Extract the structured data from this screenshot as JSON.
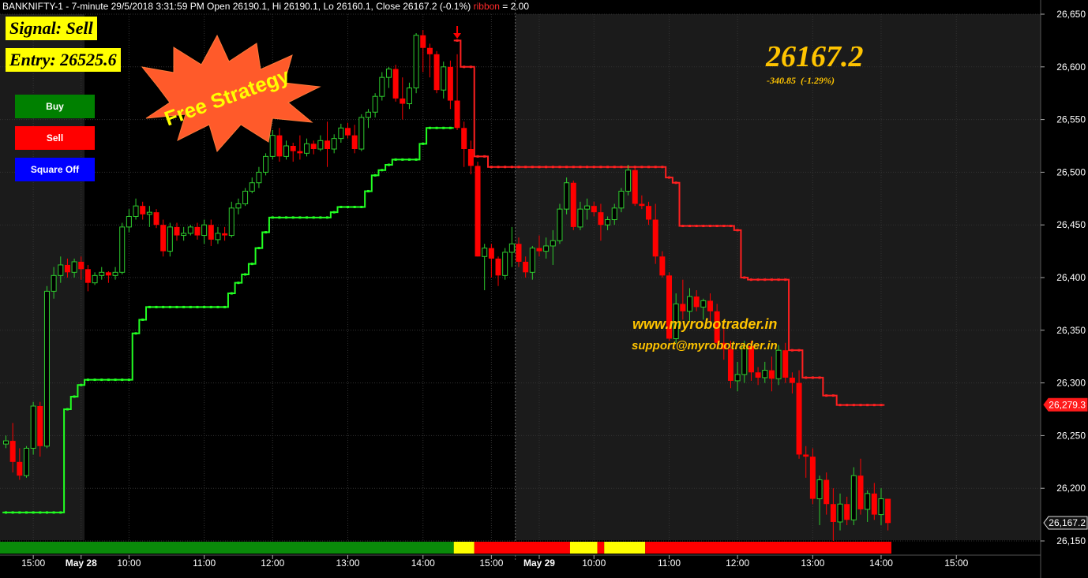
{
  "header": {
    "symbol": "BANKNIFTY-1",
    "info": " - 7-minute 29/5/2018 3:31:59 PM Open 26190.1, Hi 26190.1, Lo 26160.1, Close 26167.2 (-0.1%) ",
    "ribbon_label": "ribbon",
    "ribbon_value": " = 2.00"
  },
  "signal": {
    "label": "Signal: Sell",
    "entry": "Entry: 26525.6"
  },
  "buttons": {
    "buy": "Buy",
    "sell": "Sell",
    "square_off": "Square Off"
  },
  "badge": {
    "text": "Free Strategy"
  },
  "quote": {
    "price": "26167.2",
    "change": "-340.85  (-1.29%)"
  },
  "contact": {
    "website": "www.myrobotrader.in",
    "email": "support@myrobotrader.in"
  },
  "colors": {
    "up": "#2ecc2e",
    "down": "#ff0000",
    "support_line": "#22ff22",
    "resistance_line": "#ff2020",
    "ribbon_green": "#0a8a0a",
    "ribbon_yellow": "#ffff00",
    "ribbon_red": "#ff0000",
    "accent_text": "#ffc400",
    "buy_button": "#008000",
    "sell_button": "#ff0000",
    "square_off_button": "#0000ff"
  },
  "chart_data": {
    "type": "candlestick",
    "y_ticks": [
      26650,
      26600,
      26550,
      26500,
      26450,
      26400,
      26350,
      26300,
      26250,
      26200,
      26150
    ],
    "y_tick_labels": [
      "26,650",
      "26,600",
      "26,550",
      "26,500",
      "26,450",
      "26,400",
      "26,350",
      "26,300",
      "26,250",
      "26,200",
      "26,150"
    ],
    "ylim": [
      26125,
      26670
    ],
    "x_ticks": [
      {
        "bar": 4,
        "label": "15:00",
        "bold": false
      },
      {
        "bar": 11,
        "label": "May 28",
        "bold": true
      },
      {
        "bar": 18,
        "label": "10:00",
        "bold": false
      },
      {
        "bar": 29,
        "label": "11:00",
        "bold": false
      },
      {
        "bar": 39,
        "label": "12:00",
        "bold": false
      },
      {
        "bar": 50,
        "label": "13:00",
        "bold": false
      },
      {
        "bar": 61,
        "label": "14:00",
        "bold": false
      },
      {
        "bar": 71,
        "label": "15:00",
        "bold": false
      },
      {
        "bar": 78,
        "label": "May 29",
        "bold": true
      },
      {
        "bar": 86,
        "label": "10:00",
        "bold": false
      },
      {
        "bar": 97,
        "label": "11:00",
        "bold": false
      },
      {
        "bar": 107,
        "label": "12:00",
        "bold": false
      },
      {
        "bar": 118,
        "label": "13:00",
        "bold": false
      },
      {
        "bar": 128,
        "label": "14:00",
        "bold": false
      },
      {
        "bar": 139,
        "label": "15:00",
        "bold": false
      }
    ],
    "candles": [
      [
        26242,
        26250,
        26238,
        26245
      ],
      [
        26245,
        26262,
        26215,
        26225
      ],
      [
        26225,
        26238,
        26208,
        26212
      ],
      [
        26212,
        26240,
        26210,
        26238
      ],
      [
        26238,
        26282,
        26232,
        26278
      ],
      [
        26278,
        26282,
        26230,
        26240
      ],
      [
        26240,
        26392,
        26238,
        26387
      ],
      [
        26387,
        26410,
        26380,
        26402
      ],
      [
        26402,
        26420,
        26395,
        26412
      ],
      [
        26412,
        26418,
        26400,
        26405
      ],
      [
        26405,
        26418,
        26400,
        26415
      ],
      [
        26415,
        26420,
        26398,
        26408
      ],
      [
        26408,
        26412,
        26387,
        26395
      ],
      [
        26395,
        26405,
        26393,
        26402
      ],
      [
        26402,
        26410,
        26398,
        26405
      ],
      [
        26405,
        26406,
        26395,
        26402
      ],
      [
        26402,
        26410,
        26398,
        26405
      ],
      [
        26405,
        26452,
        26403,
        26448
      ],
      [
        26448,
        26465,
        26443,
        26458
      ],
      [
        26458,
        26475,
        26455,
        26468
      ],
      [
        26468,
        26472,
        26455,
        26460
      ],
      [
        26460,
        26468,
        26448,
        26462
      ],
      [
        26462,
        26465,
        26447,
        26450
      ],
      [
        26450,
        26455,
        26420,
        26425
      ],
      [
        26425,
        26452,
        26420,
        26448
      ],
      [
        26448,
        26452,
        26435,
        26440
      ],
      [
        26440,
        26448,
        26435,
        26442
      ],
      [
        26442,
        26450,
        26440,
        26448
      ],
      [
        26448,
        26452,
        26436,
        26440
      ],
      [
        26440,
        26455,
        26432,
        26450
      ],
      [
        26450,
        26455,
        26430,
        26436
      ],
      [
        26436,
        26448,
        26432,
        26442
      ],
      [
        26442,
        26448,
        26435,
        26440
      ],
      [
        26440,
        26472,
        26438,
        26466
      ],
      [
        26466,
        26475,
        26460,
        26470
      ],
      [
        26470,
        26485,
        26468,
        26482
      ],
      [
        26482,
        26495,
        26480,
        26490
      ],
      [
        26490,
        26505,
        26485,
        26500
      ],
      [
        26500,
        26518,
        26497,
        26515
      ],
      [
        26515,
        26540,
        26512,
        26535
      ],
      [
        26535,
        26542,
        26510,
        26515
      ],
      [
        26515,
        26530,
        26512,
        26525
      ],
      [
        26525,
        26528,
        26510,
        26520
      ],
      [
        26520,
        26535,
        26512,
        26518
      ],
      [
        26518,
        26532,
        26515,
        26527
      ],
      [
        26527,
        26530,
        26517,
        26522
      ],
      [
        26522,
        26535,
        26520,
        26530
      ],
      [
        26530,
        26548,
        26505,
        26522
      ],
      [
        26522,
        26536,
        26518,
        26532
      ],
      [
        26532,
        26546,
        26528,
        26542
      ],
      [
        26542,
        26547,
        26532,
        26535
      ],
      [
        26535,
        26545,
        26518,
        26522
      ],
      [
        26522,
        26555,
        26520,
        26552
      ],
      [
        26552,
        26560,
        26542,
        26557
      ],
      [
        26557,
        26575,
        26552,
        26572
      ],
      [
        26572,
        26595,
        26568,
        26590
      ],
      [
        26590,
        26600,
        26580,
        26598
      ],
      [
        26598,
        26602,
        26567,
        26570
      ],
      [
        26570,
        26590,
        26550,
        26565
      ],
      [
        26565,
        26585,
        26560,
        26580
      ],
      [
        26580,
        26632,
        26575,
        26630
      ],
      [
        26630,
        26635,
        26595,
        26618
      ],
      [
        26618,
        26622,
        26590,
        26612
      ],
      [
        26612,
        26615,
        26575,
        26578
      ],
      [
        26578,
        26605,
        26570,
        26600
      ],
      [
        26600,
        26606,
        26560,
        26568
      ],
      [
        26568,
        26612,
        26540,
        26542
      ],
      [
        26542,
        26548,
        26505,
        26522
      ],
      [
        26522,
        26530,
        26498,
        26506
      ],
      [
        26506,
        26510,
        26420,
        26420
      ],
      [
        26420,
        26432,
        26388,
        26428
      ],
      [
        26428,
        26432,
        26400,
        26418
      ],
      [
        26418,
        26420,
        26392,
        26402
      ],
      [
        26402,
        26428,
        26398,
        26424
      ],
      [
        26424,
        26448,
        26410,
        26432
      ],
      [
        26432,
        26438,
        26410,
        26415
      ],
      [
        26415,
        26420,
        26400,
        26405
      ],
      [
        26405,
        26430,
        26398,
        26428
      ],
      [
        26428,
        26440,
        26420,
        26425
      ],
      [
        26425,
        26438,
        26418,
        26430
      ],
      [
        26430,
        26445,
        26412,
        26435
      ],
      [
        26435,
        26470,
        26432,
        26465
      ],
      [
        26465,
        26495,
        26460,
        26490
      ],
      [
        26490,
        26492,
        26445,
        26448
      ],
      [
        26448,
        26472,
        26445,
        26465
      ],
      [
        26465,
        26475,
        26455,
        26468
      ],
      [
        26468,
        26472,
        26458,
        26462
      ],
      [
        26462,
        26470,
        26435,
        26450
      ],
      [
        26450,
        26458,
        26445,
        26455
      ],
      [
        26455,
        26470,
        26450,
        26466
      ],
      [
        26466,
        26485,
        26462,
        26482
      ],
      [
        26482,
        26507,
        26478,
        26502
      ],
      [
        26502,
        26504,
        26468,
        26470
      ],
      [
        26470,
        26478,
        26465,
        26468
      ],
      [
        26468,
        26472,
        26450,
        26455
      ],
      [
        26455,
        26470,
        26413,
        26420
      ],
      [
        26420,
        26425,
        26400,
        26402
      ],
      [
        26402,
        26405,
        26340,
        26342
      ],
      [
        26342,
        26385,
        26338,
        26375
      ],
      [
        26375,
        26398,
        26360,
        26368
      ],
      [
        26368,
        26390,
        26358,
        26382
      ],
      [
        26382,
        26388,
        26368,
        26372
      ],
      [
        26372,
        26380,
        26360,
        26378
      ],
      [
        26378,
        26385,
        26358,
        26368
      ],
      [
        26368,
        26375,
        26332,
        26338
      ],
      [
        26338,
        26355,
        26322,
        26332
      ],
      [
        26332,
        26340,
        26295,
        26302
      ],
      [
        26302,
        26320,
        26292,
        26308
      ],
      [
        26308,
        26340,
        26300,
        26335
      ],
      [
        26335,
        26340,
        26302,
        26310
      ],
      [
        26310,
        26315,
        26298,
        26305
      ],
      [
        26305,
        26320,
        26300,
        26312
      ],
      [
        26312,
        26325,
        26292,
        26304
      ],
      [
        26304,
        26336,
        26298,
        26331
      ],
      [
        26331,
        26338,
        26300,
        26305
      ],
      [
        26305,
        26310,
        26290,
        26300
      ],
      [
        26300,
        26312,
        26228,
        26232
      ],
      [
        26232,
        26240,
        26210,
        26230
      ],
      [
        26230,
        26238,
        26185,
        26190
      ],
      [
        26190,
        26212,
        26165,
        26208
      ],
      [
        26208,
        26215,
        26175,
        26185
      ],
      [
        26185,
        26200,
        26150,
        26168
      ],
      [
        26168,
        26195,
        26160,
        26185
      ],
      [
        26185,
        26192,
        26165,
        26170
      ],
      [
        26170,
        26220,
        26165,
        26212
      ],
      [
        26212,
        26228,
        26175,
        26180
      ],
      [
        26180,
        26198,
        26168,
        26195
      ],
      [
        26195,
        26205,
        26170,
        26175
      ],
      [
        26175,
        26200,
        26165,
        26190
      ],
      [
        26190,
        26190,
        26160,
        26167
      ]
    ],
    "support_line": [
      {
        "from": 0,
        "to": 8,
        "value": 26177
      },
      {
        "from": 9,
        "to": 9,
        "value": 26275
      },
      {
        "from": 10,
        "to": 10,
        "value": 26287
      },
      {
        "from": 11,
        "to": 11,
        "value": 26298
      },
      {
        "from": 12,
        "to": 18,
        "value": 26303
      },
      {
        "from": 19,
        "to": 19,
        "value": 26347
      },
      {
        "from": 20,
        "to": 20,
        "value": 26360
      },
      {
        "from": 21,
        "to": 32,
        "value": 26372
      },
      {
        "from": 33,
        "to": 33,
        "value": 26385
      },
      {
        "from": 34,
        "to": 34,
        "value": 26395
      },
      {
        "from": 35,
        "to": 35,
        "value": 26403
      },
      {
        "from": 36,
        "to": 36,
        "value": 26413
      },
      {
        "from": 37,
        "to": 37,
        "value": 26428
      },
      {
        "from": 38,
        "to": 38,
        "value": 26443
      },
      {
        "from": 39,
        "to": 47,
        "value": 26457
      },
      {
        "from": 48,
        "to": 48,
        "value": 26462
      },
      {
        "from": 49,
        "to": 52,
        "value": 26467
      },
      {
        "from": 53,
        "to": 53,
        "value": 26482
      },
      {
        "from": 54,
        "to": 54,
        "value": 26497
      },
      {
        "from": 55,
        "to": 55,
        "value": 26502
      },
      {
        "from": 56,
        "to": 56,
        "value": 26507
      },
      {
        "from": 57,
        "to": 60,
        "value": 26512
      },
      {
        "from": 61,
        "to": 61,
        "value": 26527
      },
      {
        "from": 62,
        "to": 65,
        "value": 26542
      }
    ],
    "resistance_line": [
      {
        "from": 66,
        "to": 66,
        "value": 26625
      },
      {
        "from": 67,
        "to": 68,
        "value": 26600
      },
      {
        "from": 69,
        "to": 70,
        "value": 26515
      },
      {
        "from": 71,
        "to": 96,
        "value": 26505
      },
      {
        "from": 97,
        "to": 97,
        "value": 26495
      },
      {
        "from": 98,
        "to": 98,
        "value": 26490
      },
      {
        "from": 99,
        "to": 106,
        "value": 26449
      },
      {
        "from": 107,
        "to": 107,
        "value": 26445
      },
      {
        "from": 108,
        "to": 108,
        "value": 26400
      },
      {
        "from": 109,
        "to": 114,
        "value": 26398
      },
      {
        "from": 115,
        "to": 116,
        "value": 26331
      },
      {
        "from": 117,
        "to": 119,
        "value": 26305
      },
      {
        "from": 120,
        "to": 121,
        "value": 26288
      },
      {
        "from": 122,
        "to": 128,
        "value": 26279
      }
    ],
    "signal_arrow_bar": 66,
    "ribbon_segments": [
      {
        "from": 0,
        "to": 65,
        "color": "green"
      },
      {
        "from": 66,
        "to": 68,
        "color": "yellow"
      },
      {
        "from": 69,
        "to": 82,
        "color": "red"
      },
      {
        "from": 83,
        "to": 86,
        "color": "yellow"
      },
      {
        "from": 87,
        "to": 87,
        "color": "red"
      },
      {
        "from": 88,
        "to": 93,
        "color": "yellow"
      },
      {
        "from": 94,
        "to": 129,
        "color": "red"
      }
    ],
    "price_tags": [
      {
        "label": "26,279.3",
        "value": 26279.3,
        "color": "red"
      },
      {
        "label": "26,167.2",
        "value": 26167.2,
        "color": "black"
      }
    ]
  }
}
